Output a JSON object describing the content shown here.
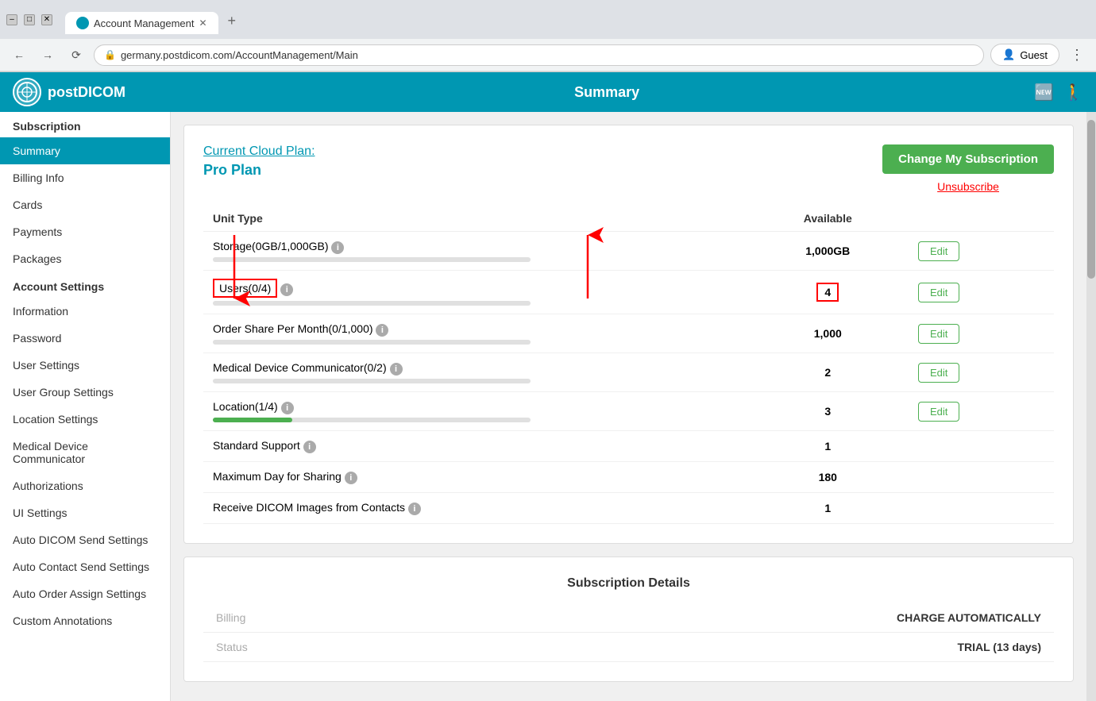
{
  "browser": {
    "tab_title": "Account Management",
    "url": "germany.postdicom.com/AccountManagement/Main",
    "new_tab_symbol": "+",
    "guest_label": "Guest"
  },
  "header": {
    "logo_text": "postDICOM",
    "title": "Summary"
  },
  "sidebar": {
    "subscription_section": "Subscription",
    "account_section": "Account Settings",
    "items": [
      {
        "id": "summary",
        "label": "Summary",
        "active": true
      },
      {
        "id": "billing-info",
        "label": "Billing Info",
        "active": false
      },
      {
        "id": "cards",
        "label": "Cards",
        "active": false
      },
      {
        "id": "payments",
        "label": "Payments",
        "active": false
      },
      {
        "id": "packages",
        "label": "Packages",
        "active": false
      },
      {
        "id": "information",
        "label": "Information",
        "active": false
      },
      {
        "id": "password",
        "label": "Password",
        "active": false
      },
      {
        "id": "user-settings",
        "label": "User Settings",
        "active": false
      },
      {
        "id": "user-group-settings",
        "label": "User Group Settings",
        "active": false
      },
      {
        "id": "location-settings",
        "label": "Location Settings",
        "active": false
      },
      {
        "id": "medical-device",
        "label": "Medical Device Communicator",
        "active": false
      },
      {
        "id": "authorizations",
        "label": "Authorizations",
        "active": false
      },
      {
        "id": "ui-settings",
        "label": "UI Settings",
        "active": false
      },
      {
        "id": "auto-dicom",
        "label": "Auto DICOM Send Settings",
        "active": false
      },
      {
        "id": "auto-contact",
        "label": "Auto Contact Send Settings",
        "active": false
      },
      {
        "id": "auto-order",
        "label": "Auto Order Assign Settings",
        "active": false
      },
      {
        "id": "custom-annotations",
        "label": "Custom Annotations",
        "active": false
      }
    ]
  },
  "plan": {
    "current_plan_label": "Current Cloud Plan:",
    "plan_name": "Pro Plan",
    "change_button": "Change My Subscription",
    "unsubscribe_label": "Unsubscribe"
  },
  "units_table": {
    "col_unit_type": "Unit Type",
    "col_available": "Available",
    "rows": [
      {
        "name": "Storage(0GB/1,000GB)",
        "has_info": true,
        "available": "1,000GB",
        "has_edit": true,
        "progress": 0,
        "progress_color": "#e0e0e0"
      },
      {
        "name": "Users(0/4)",
        "has_info": true,
        "available": "4",
        "has_edit": true,
        "progress": 0,
        "progress_color": "#e0e0e0",
        "highlight": true
      },
      {
        "name": "Order Share Per Month(0/1,000)",
        "has_info": true,
        "available": "1,000",
        "has_edit": true,
        "progress": 0,
        "progress_color": "#e0e0e0"
      },
      {
        "name": "Medical Device Communicator(0/2)",
        "has_info": true,
        "available": "2",
        "has_edit": true,
        "progress": 0,
        "progress_color": "#e0e0e0"
      },
      {
        "name": "Location(1/4)",
        "has_info": true,
        "available": "3",
        "has_edit": true,
        "progress": 25,
        "progress_color": "#4caf50"
      },
      {
        "name": "Standard Support",
        "has_info": true,
        "available": "1",
        "has_edit": false,
        "progress": null
      },
      {
        "name": "Maximum Day for Sharing",
        "has_info": true,
        "available": "180",
        "has_edit": false,
        "progress": null
      },
      {
        "name": "Receive DICOM Images from Contacts",
        "has_info": true,
        "available": "1",
        "has_edit": false,
        "progress": null
      }
    ]
  },
  "subscription_details": {
    "title": "Subscription Details",
    "rows": [
      {
        "label": "Billing",
        "value": "CHARGE AUTOMATICALLY"
      },
      {
        "label": "Status",
        "value": "TRIAL (13 days)"
      }
    ]
  }
}
